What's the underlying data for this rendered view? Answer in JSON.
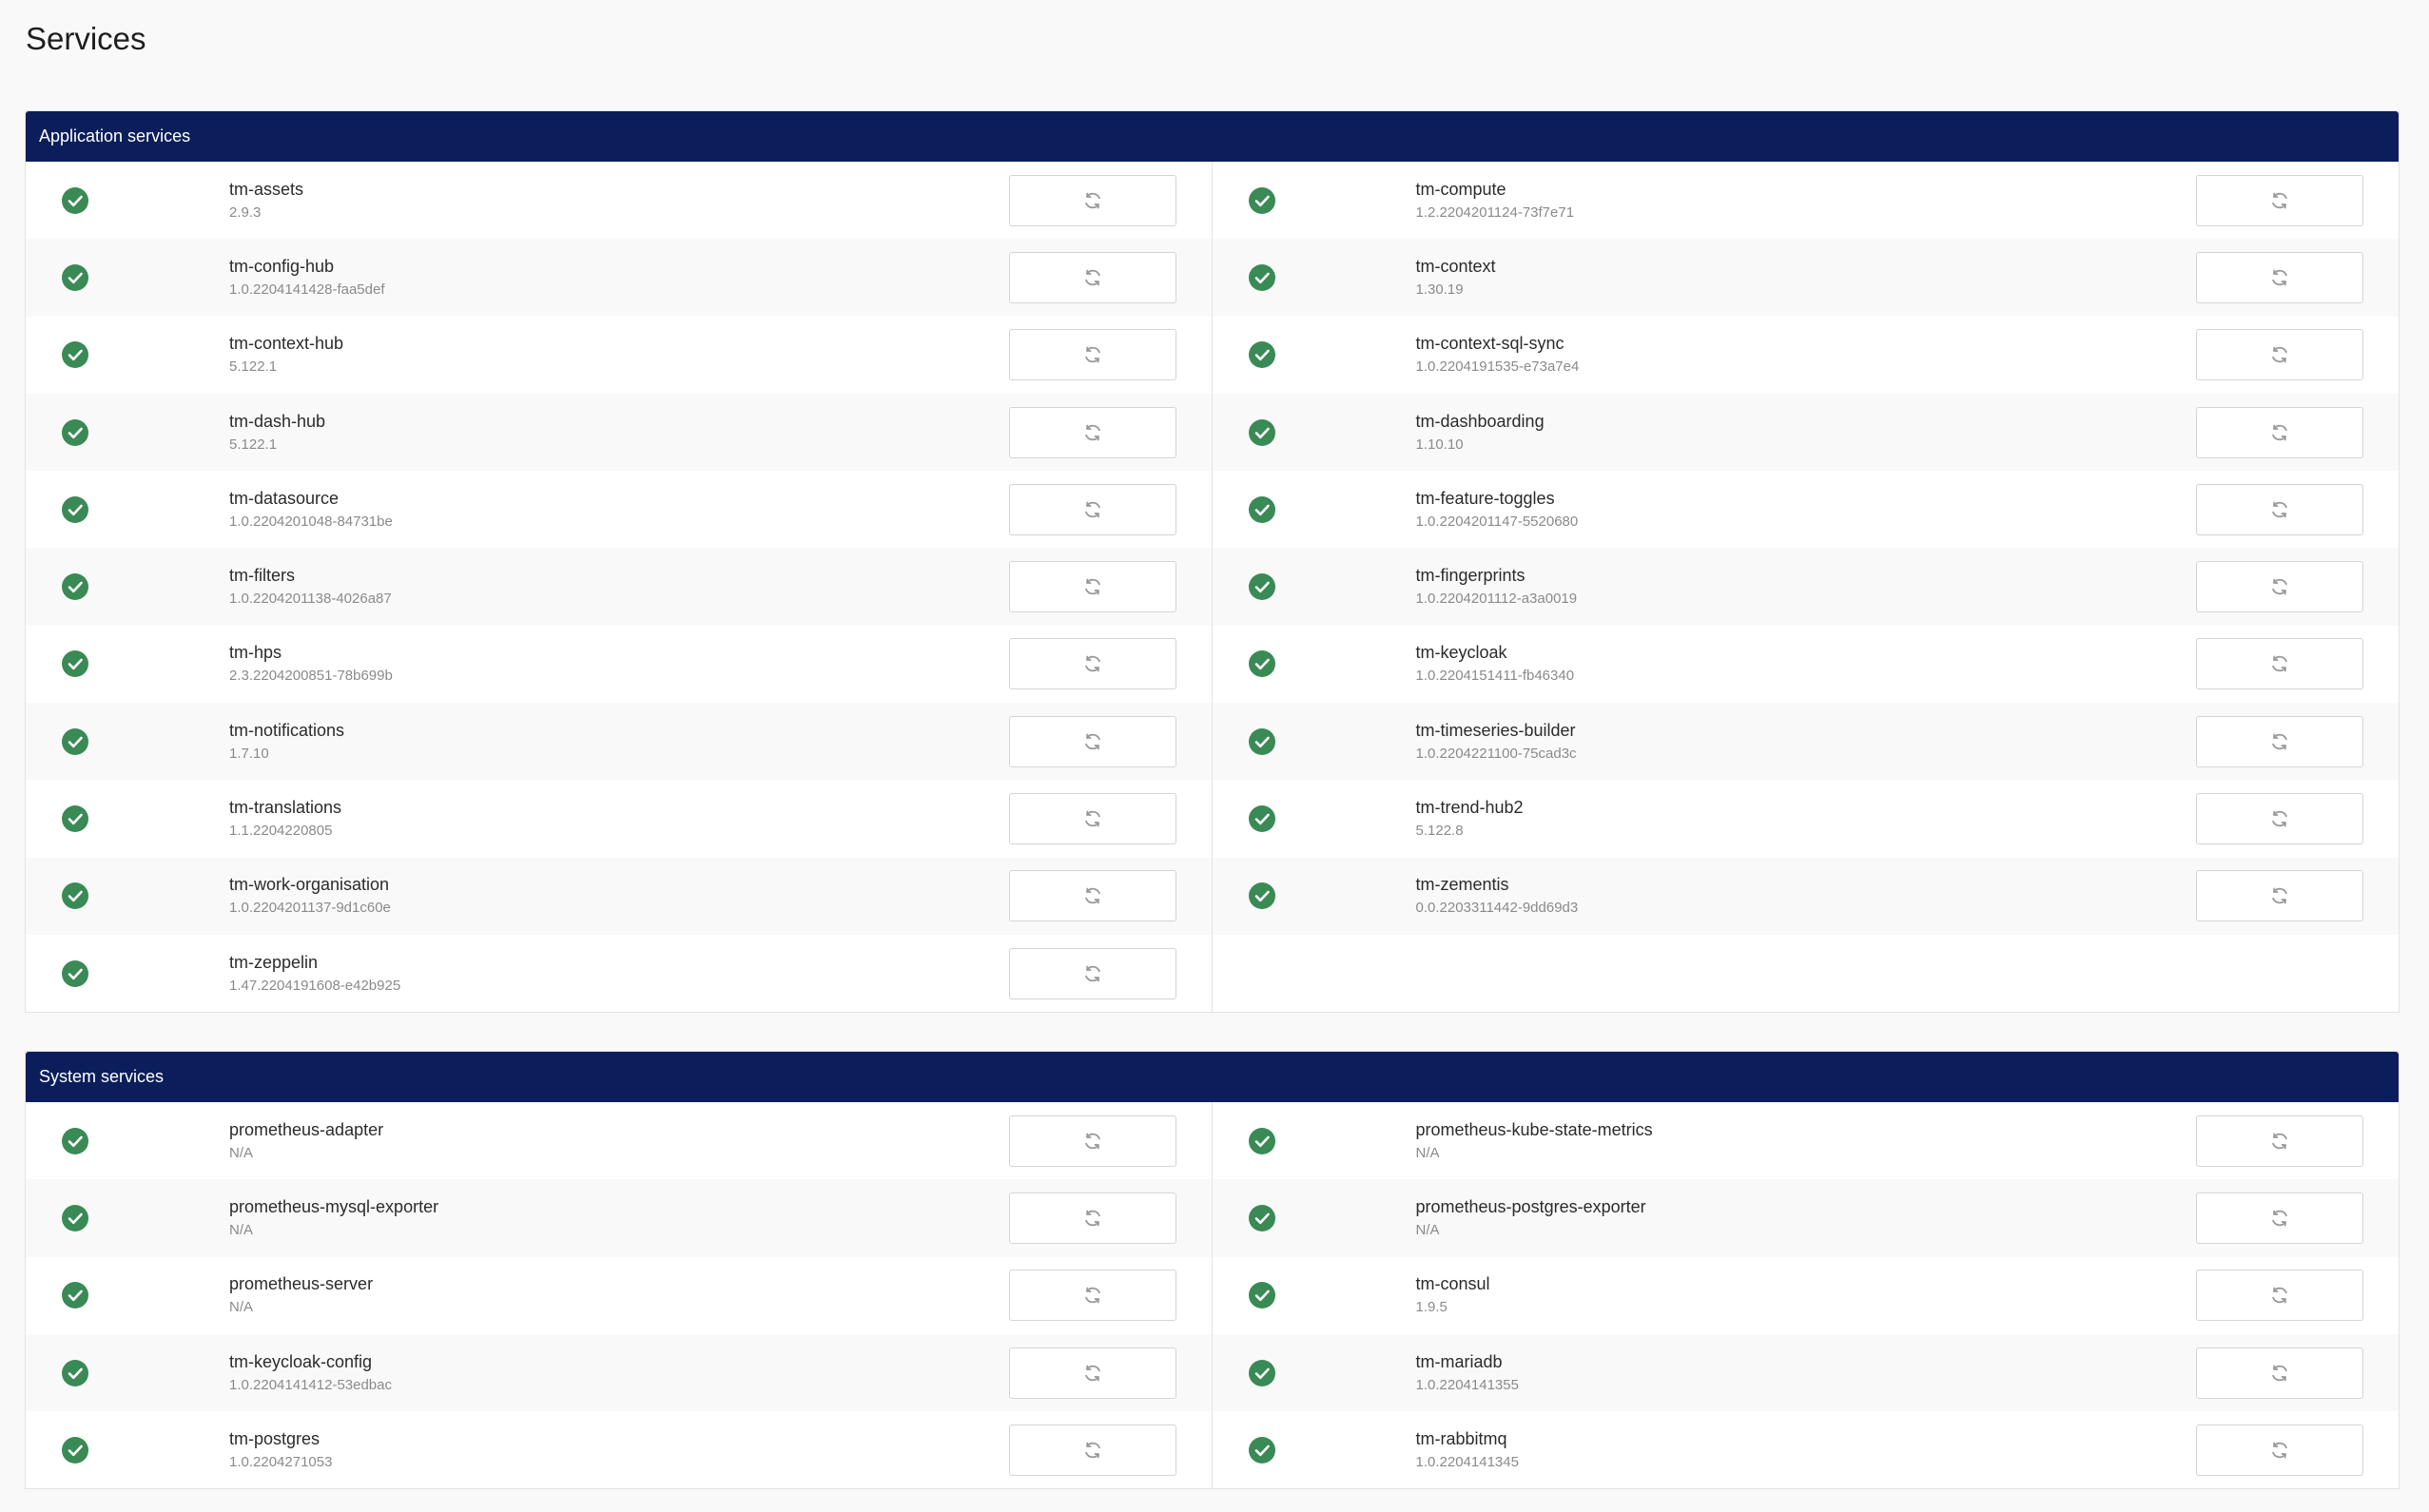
{
  "page": {
    "title": "Services"
  },
  "colors": {
    "header_bg": "#0b1e5b",
    "status_ok": "#3a8a55",
    "row_alt": "#f9f9f9"
  },
  "icons": {
    "status": "check-circle-icon",
    "restart": "refresh-icon"
  },
  "sections": [
    {
      "title": "Application services",
      "left": [
        {
          "name": "tm-assets",
          "version": "2.9.3",
          "status": "ok"
        },
        {
          "name": "tm-config-hub",
          "version": "1.0.2204141428-faa5def",
          "status": "ok"
        },
        {
          "name": "tm-context-hub",
          "version": "5.122.1",
          "status": "ok"
        },
        {
          "name": "tm-dash-hub",
          "version": "5.122.1",
          "status": "ok"
        },
        {
          "name": "tm-datasource",
          "version": "1.0.2204201048-84731be",
          "status": "ok"
        },
        {
          "name": "tm-filters",
          "version": "1.0.2204201138-4026a87",
          "status": "ok"
        },
        {
          "name": "tm-hps",
          "version": "2.3.2204200851-78b699b",
          "status": "ok"
        },
        {
          "name": "tm-notifications",
          "version": "1.7.10",
          "status": "ok"
        },
        {
          "name": "tm-translations",
          "version": "1.1.2204220805",
          "status": "ok"
        },
        {
          "name": "tm-work-organisation",
          "version": "1.0.2204201137-9d1c60e",
          "status": "ok"
        },
        {
          "name": "tm-zeppelin",
          "version": "1.47.2204191608-e42b925",
          "status": "ok"
        }
      ],
      "right": [
        {
          "name": "tm-compute",
          "version": "1.2.2204201124-73f7e71",
          "status": "ok"
        },
        {
          "name": "tm-context",
          "version": "1.30.19",
          "status": "ok"
        },
        {
          "name": "tm-context-sql-sync",
          "version": "1.0.2204191535-e73a7e4",
          "status": "ok"
        },
        {
          "name": "tm-dashboarding",
          "version": "1.10.10",
          "status": "ok"
        },
        {
          "name": "tm-feature-toggles",
          "version": "1.0.2204201147-5520680",
          "status": "ok"
        },
        {
          "name": "tm-fingerprints",
          "version": "1.0.2204201112-a3a0019",
          "status": "ok"
        },
        {
          "name": "tm-keycloak",
          "version": "1.0.2204151411-fb46340",
          "status": "ok"
        },
        {
          "name": "tm-timeseries-builder",
          "version": "1.0.2204221100-75cad3c",
          "status": "ok"
        },
        {
          "name": "tm-trend-hub2",
          "version": "5.122.8",
          "status": "ok"
        },
        {
          "name": "tm-zementis",
          "version": "0.0.2203311442-9dd69d3",
          "status": "ok"
        }
      ]
    },
    {
      "title": "System services",
      "left": [
        {
          "name": "prometheus-adapter",
          "version": "N/A",
          "status": "ok"
        },
        {
          "name": "prometheus-mysql-exporter",
          "version": "N/A",
          "status": "ok"
        },
        {
          "name": "prometheus-server",
          "version": "N/A",
          "status": "ok"
        },
        {
          "name": "tm-keycloak-config",
          "version": "1.0.2204141412-53edbac",
          "status": "ok"
        },
        {
          "name": "tm-postgres",
          "version": "1.0.2204271053",
          "status": "ok"
        }
      ],
      "right": [
        {
          "name": "prometheus-kube-state-metrics",
          "version": "N/A",
          "status": "ok"
        },
        {
          "name": "prometheus-postgres-exporter",
          "version": "N/A",
          "status": "ok"
        },
        {
          "name": "tm-consul",
          "version": "1.9.5",
          "status": "ok"
        },
        {
          "name": "tm-mariadb",
          "version": "1.0.2204141355",
          "status": "ok"
        },
        {
          "name": "tm-rabbitmq",
          "version": "1.0.2204141345",
          "status": "ok"
        }
      ]
    }
  ]
}
